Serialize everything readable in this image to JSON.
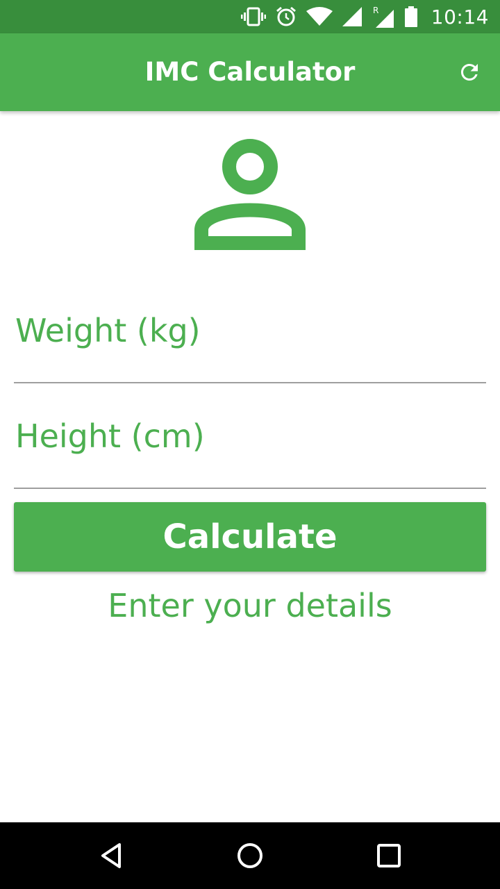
{
  "status_bar": {
    "time": "10:14",
    "icons": [
      "vibrate-icon",
      "alarm-icon",
      "wifi-icon",
      "signal-icon",
      "roaming-signal-icon",
      "battery-icon"
    ],
    "roaming_label": "R"
  },
  "app_bar": {
    "title": "IMC Calculator",
    "action_icon": "refresh-icon"
  },
  "form": {
    "avatar_icon": "person-icon",
    "weight": {
      "placeholder": "Weight (kg)",
      "value": ""
    },
    "height": {
      "placeholder": "Height (cm)",
      "value": ""
    },
    "calculate_label": "Calculate",
    "info_text": "Enter your details"
  },
  "nav_bar": {
    "icons": [
      "back-icon",
      "home-icon",
      "recents-icon"
    ]
  },
  "colors": {
    "primary": "#4CAF50",
    "primary_dark": "#388E3C",
    "background": "#FFFFFF",
    "nav_bar": "#000000",
    "divider": "#9E9E9E"
  }
}
